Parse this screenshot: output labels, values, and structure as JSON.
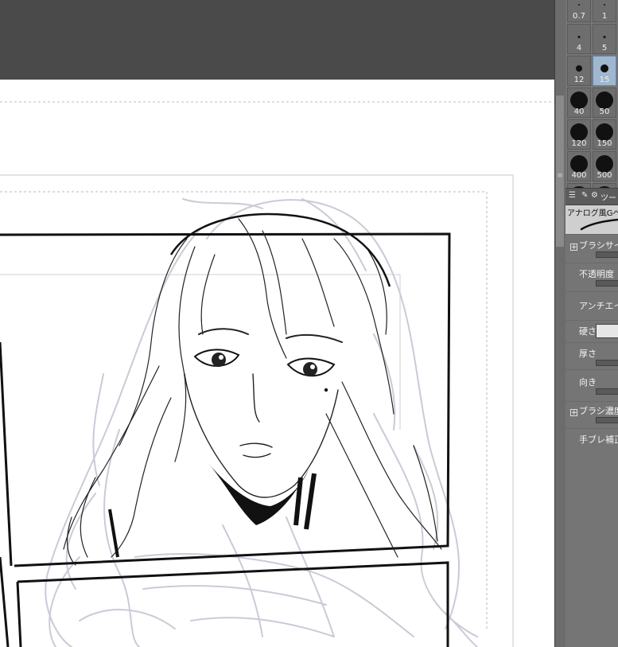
{
  "brush_sizes": [
    {
      "label": "0.7"
    },
    {
      "label": "1"
    },
    {
      "label": "4"
    },
    {
      "label": "5"
    },
    {
      "label": "12"
    },
    {
      "label": "15",
      "selected": true
    },
    {
      "label": "40"
    },
    {
      "label": "50"
    },
    {
      "label": "120"
    },
    {
      "label": "150"
    },
    {
      "label": "400"
    },
    {
      "label": "500"
    },
    {
      "label": ""
    },
    {
      "label": ""
    }
  ],
  "tool_panel": {
    "tab_label": "ツー",
    "subtool_name": "アナログ風Gペ"
  },
  "properties": {
    "brush_size": "ブラシサイズ",
    "opacity": "不透明度",
    "antialiasing": "アンチエイリアス",
    "hardness": "硬さ",
    "thickness": "厚さ",
    "direction": "向き",
    "brush_density": "ブラシ濃度",
    "stabilization": "手ブレ補正"
  },
  "icons": {
    "panel_menu": "panel-menu-icon",
    "settings": "gear-icon",
    "pen": "pen-tool-icon",
    "splitter": "splitter-grip-icon"
  },
  "colors": {
    "sketch": "#c9cbd7",
    "ink": "#111111",
    "selected_brush": "#9fb7cf"
  }
}
